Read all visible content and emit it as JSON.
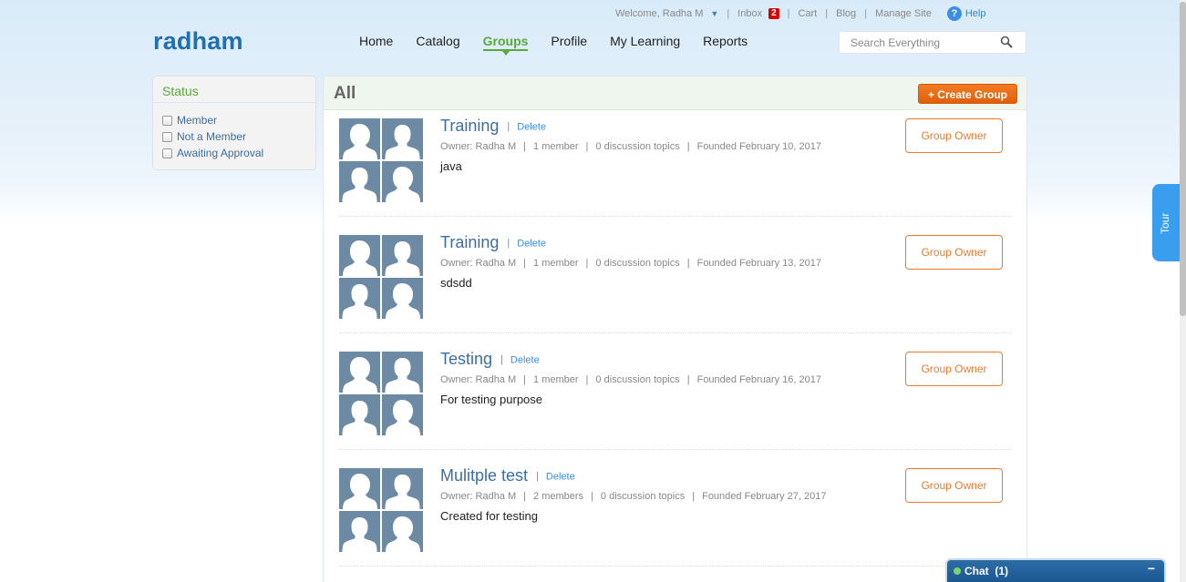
{
  "topbar": {
    "welcome": "Welcome, Radha M",
    "inbox": "Inbox",
    "inbox_count": "2",
    "cart": "Cart",
    "blog": "Blog",
    "manage_site": "Manage Site",
    "help": "Help",
    "sep": "|"
  },
  "brand": {
    "logo": "radham"
  },
  "nav": {
    "items": [
      {
        "label": "Home"
      },
      {
        "label": "Catalog"
      },
      {
        "label": "Groups"
      },
      {
        "label": "Profile"
      },
      {
        "label": "My Learning"
      },
      {
        "label": "Reports"
      }
    ],
    "active": "Groups"
  },
  "search": {
    "placeholder": "Search Everything"
  },
  "sidebar": {
    "title": "Status",
    "filters": [
      {
        "label": "Member"
      },
      {
        "label": "Not a Member"
      },
      {
        "label": "Awaiting Approval"
      }
    ]
  },
  "main": {
    "title": "All",
    "create_label": "+ Create Group",
    "delete_label": "Delete",
    "owner_label": "Group Owner",
    "groups": [
      {
        "name": "Training",
        "owner": "Owner: Radha M",
        "members": "1 member",
        "topics": "0 discussion topics",
        "founded": "Founded February 10, 2017",
        "description": "java"
      },
      {
        "name": "Training",
        "owner": "Owner: Radha M",
        "members": "1 member",
        "topics": "0 discussion topics",
        "founded": "Founded February 13, 2017",
        "description": "sdsdd"
      },
      {
        "name": "Testing",
        "owner": "Owner: Radha M",
        "members": "1 member",
        "topics": "0 discussion topics",
        "founded": "Founded February 16, 2017",
        "description": "For testing purpose"
      },
      {
        "name": "Mulitple test",
        "owner": "Owner: Radha M",
        "members": "2 members",
        "topics": "0 discussion topics",
        "founded": "Founded February 27, 2017",
        "description": "Created for testing"
      }
    ]
  },
  "tour": {
    "label": "Tour"
  },
  "chat": {
    "label": "Chat",
    "count": "(1)",
    "minimize": "−"
  },
  "colors": {
    "brand": "#1f6fb2",
    "accent_green": "#5aa83a",
    "accent_orange": "#ec7a2c",
    "link": "#3a6ea5"
  }
}
